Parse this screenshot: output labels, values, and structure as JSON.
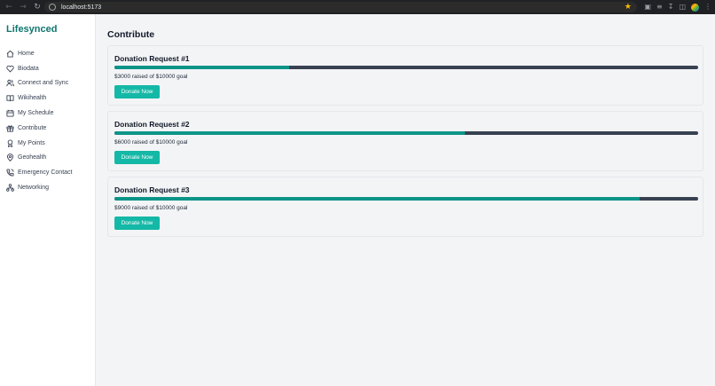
{
  "browser": {
    "url": "localhost:5173"
  },
  "sidebar": {
    "brand": "Lifesynced",
    "items": [
      {
        "label": "Home",
        "icon": "home-icon"
      },
      {
        "label": "Biodata",
        "icon": "heart-icon"
      },
      {
        "label": "Connect and Sync",
        "icon": "users-icon"
      },
      {
        "label": "Wikihealth",
        "icon": "book-icon"
      },
      {
        "label": "My Schedule",
        "icon": "calendar-icon"
      },
      {
        "label": "Contribute",
        "icon": "gift-icon"
      },
      {
        "label": "My Points",
        "icon": "award-icon"
      },
      {
        "label": "Geohealth",
        "icon": "map-pin-icon"
      },
      {
        "label": "Emergency Contact",
        "icon": "phone-icon"
      },
      {
        "label": "Networking",
        "icon": "network-icon"
      }
    ]
  },
  "main": {
    "title": "Contribute",
    "requests": [
      {
        "title": "Donation Request #1",
        "raised_text": "$3000 raised of $10000 goal",
        "progress": 0.3,
        "button": "Donate Now"
      },
      {
        "title": "Donation Request #2",
        "raised_text": "$6000 raised of $10000 goal",
        "progress": 0.6,
        "button": "Donate Now"
      },
      {
        "title": "Donation Request #3",
        "raised_text": "$9000 raised of $10000 goal",
        "progress": 0.9,
        "button": "Donate Now"
      }
    ]
  },
  "colors": {
    "brand": "#0f766e",
    "progress_fill": "#0d9488",
    "progress_track": "#374151",
    "button": "#14b8a6"
  }
}
